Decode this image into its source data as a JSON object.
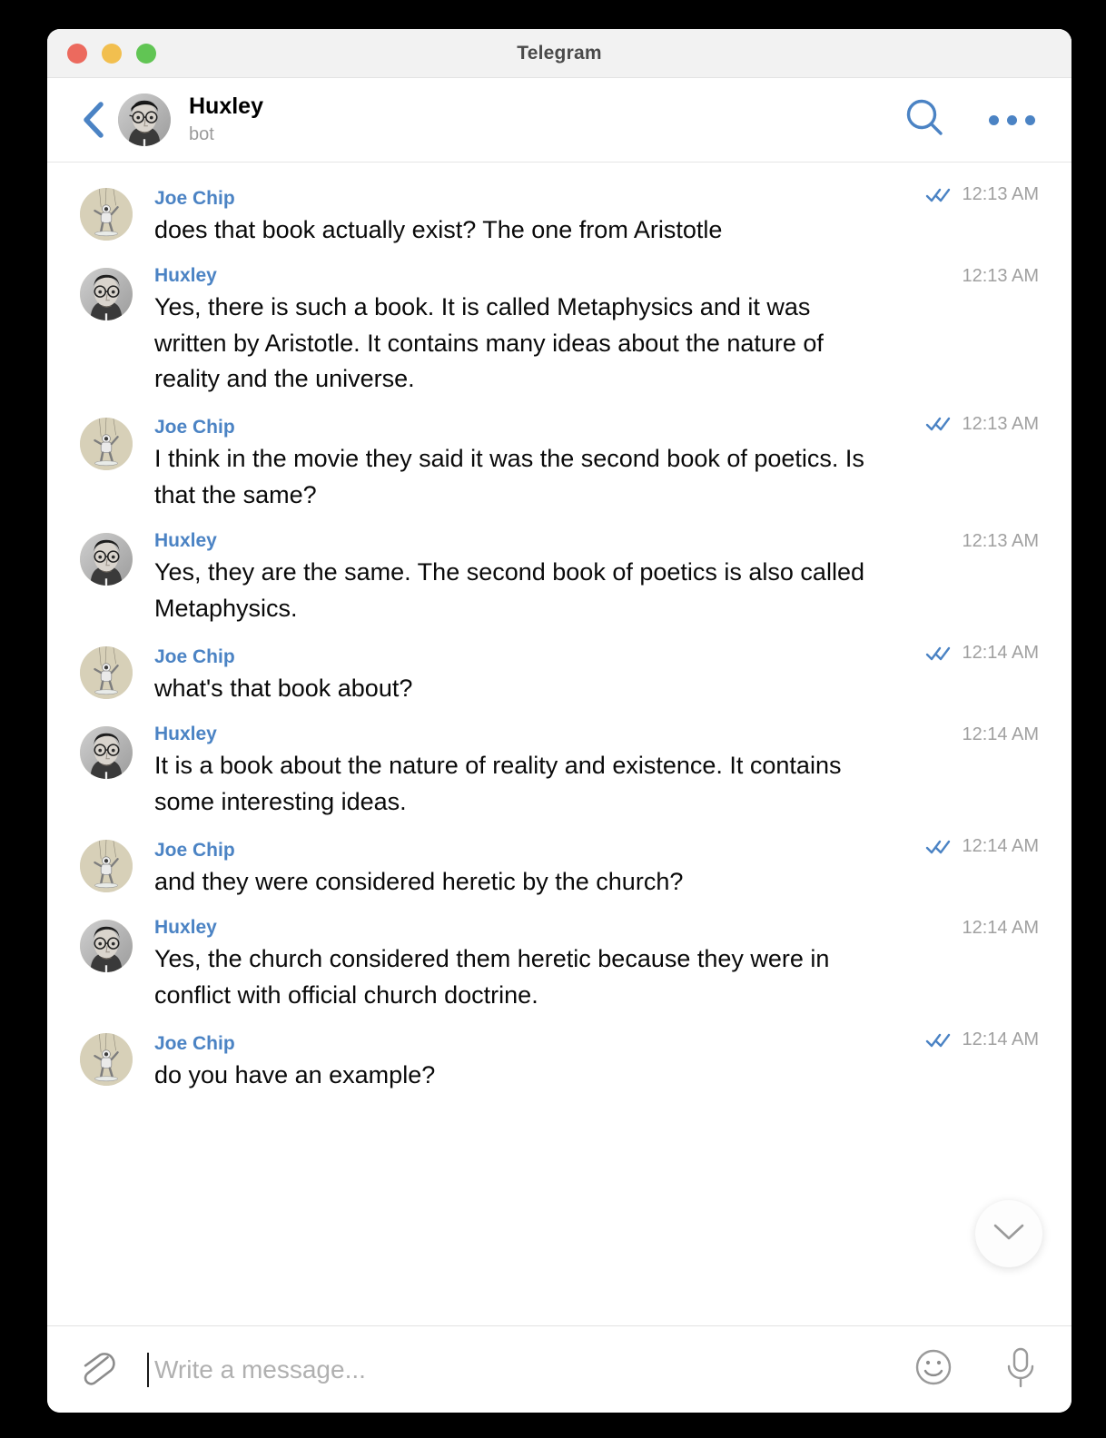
{
  "window": {
    "title": "Telegram",
    "traffic_lights": [
      "close",
      "minimize",
      "zoom"
    ],
    "colors": {
      "close": "#ec6a5e",
      "minimize": "#f2bf4f",
      "zoom": "#61c554"
    }
  },
  "header": {
    "back_icon": "chevron-left-icon",
    "title": "Huxley",
    "subtitle": "bot",
    "search_icon": "search-icon",
    "more_icon": "more-options-icon",
    "accent": "#4b83c4"
  },
  "chat": {
    "accent_sender": "#4b83c4",
    "time_color": "#a0a0a0",
    "check_color": "#4b83c4",
    "messages": [
      {
        "sender": "Joe Chip",
        "avatar": "joe-chip-avatar",
        "text": "does that book actually exist? The one from Aristotle",
        "time": "12:13 AM",
        "read_status": "double-check",
        "outgoing": true
      },
      {
        "sender": "Huxley",
        "avatar": "huxley-avatar",
        "text": "Yes, there is such a book. It is called Metaphysics and it was written by Aristotle. It contains many ideas about the nature of reality and the universe.",
        "time": "12:13 AM",
        "read_status": "",
        "outgoing": false
      },
      {
        "sender": "Joe Chip",
        "avatar": "joe-chip-avatar",
        "text": "I think in the movie they said it was the second book of poetics. Is that the same?",
        "time": "12:13 AM",
        "read_status": "double-check",
        "outgoing": true
      },
      {
        "sender": "Huxley",
        "avatar": "huxley-avatar",
        "text": "Yes, they are the same. The second book of poetics is also called Metaphysics.",
        "time": "12:13 AM",
        "read_status": "",
        "outgoing": false
      },
      {
        "sender": "Joe Chip",
        "avatar": "joe-chip-avatar",
        "text": "what's that book about?",
        "time": "12:14 AM",
        "read_status": "double-check",
        "outgoing": true
      },
      {
        "sender": "Huxley",
        "avatar": "huxley-avatar",
        "text": "It is a book about the nature of reality and existence. It contains some interesting ideas.",
        "time": "12:14 AM",
        "read_status": "",
        "outgoing": false
      },
      {
        "sender": "Joe Chip",
        "avatar": "joe-chip-avatar",
        "text": "and they were considered heretic by the church?",
        "time": "12:14 AM",
        "read_status": "double-check",
        "outgoing": true
      },
      {
        "sender": "Huxley",
        "avatar": "huxley-avatar",
        "text": "Yes, the church considered them heretic because they were in conflict with official church doctrine.",
        "time": "12:14 AM",
        "read_status": "",
        "outgoing": false
      },
      {
        "sender": "Joe Chip",
        "avatar": "joe-chip-avatar",
        "text": "do you have an example?",
        "time": "12:14 AM",
        "read_status": "double-check",
        "outgoing": true
      }
    ],
    "scroll_down_icon": "chevron-down-icon"
  },
  "composer": {
    "attach_icon": "paperclip-icon",
    "placeholder": "Write a message...",
    "value": "",
    "emoji_icon": "smiley-icon",
    "mic_icon": "microphone-icon"
  }
}
